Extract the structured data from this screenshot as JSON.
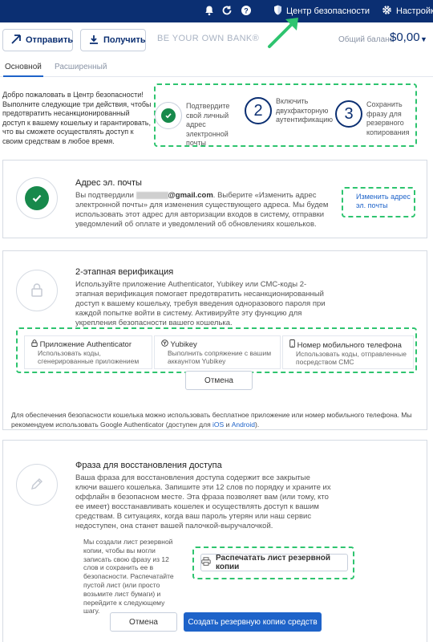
{
  "topbar": {
    "security_label": "Центр безопасности",
    "settings_label": "Настройки",
    "bell_icon": "bell-icon",
    "refresh_icon": "refresh-icon",
    "help_icon": "help-icon"
  },
  "header": {
    "send_label": "Отправить",
    "receive_label": "Получить",
    "brand": "BE YOUR OWN BANK®",
    "balance_label": "Общий баланс",
    "balance_value": "$0,00"
  },
  "tabs": [
    {
      "label": "Основной",
      "active": true
    },
    {
      "label": "Расширенный",
      "active": false
    }
  ],
  "welcome": {
    "text": "Добро пожаловать в Центр безопасности! Выполните следующие три действия, чтобы предотвратить несанкционированный доступ к вашему кошельку и гарантировать, что вы сможете осуществлять доступ к своим средствам в любое время."
  },
  "steps": [
    {
      "number": "",
      "done": true,
      "text": "Подтвердите свой личный адрес электронной почты"
    },
    {
      "number": "2",
      "done": false,
      "text": "Включить двухфакторную аутентификацию"
    },
    {
      "number": "3",
      "done": false,
      "text": "Сохранить фразу для резервного копирования"
    }
  ],
  "email_card": {
    "title": "Адрес эл. почты",
    "text_before": "Вы подтвердили ",
    "email_suffix": "@gmail.com",
    "text_after": ". Выберите «Изменить адрес электронной почты» для изменения существующего адреса. Мы будем использовать этот адрес для авторизации входов в систему, отправки уведомлений об оплате и уведомлений об обновлениях кошельков.",
    "change_link": "Изменить адрес эл. почты"
  },
  "twofa_card": {
    "title": "2-этапная верификация",
    "text": "Используйте приложение Authenticator, Yubikey или СМС-коды 2-этапная верификация помогает предотвратить несанкционированный доступ к вашему кошельку, требуя введения одноразового пароля при каждой попытке войти в систему. Активируйте эту функцию для укрепления безопасности вашего кошелька.",
    "options": [
      {
        "title": "Приложение Authenticator",
        "desc": "Использовать коды, сгенерированные приложением",
        "icon": "lock-icon"
      },
      {
        "title": "Yubikey",
        "desc": "Выполнить сопряжение с вашим аккаунтом Yubikey",
        "icon": "yubikey-icon"
      },
      {
        "title": "Номер мобильного телефона",
        "desc": "Использовать коды, отправленные посредством СМС",
        "icon": "phone-icon"
      }
    ],
    "cancel_label": "Отмена",
    "note": "Для обеспечения безопасности кошелька можно использовать бесплатное приложение или номер мобильного телефона. Мы рекомендуем использовать Google Authenticator (доступен для ",
    "note_ios": "iOS",
    "note_and": " и ",
    "note_android": "Android",
    "note_end": ")."
  },
  "phrase_card": {
    "title": "Фраза для восстановления доступа",
    "text": "Ваша фраза для восстановления доступа содержит все закрытые ключи вашего кошелька. Запишите эти 12 слов по порядку и храните их оффлайн в безопасном месте. Эта фраза позволяет вам (или тому, кто ее имеет) восстанавливать кошелек и осуществлять доступ к вашим средствам. В ситуациях, когда ваш пароль утерян или наш сервис недоступен, она станет вашей палочкой-выручалочкой.",
    "backup_text": "Мы создали лист резервной копии, чтобы вы могли записать свою фразу из 12 слов и сохранить ее в безопасности. Распечатайте пустой лист (или просто возьмите лист бумаги) и перейдите к следующему шагу.",
    "print_label": "Распечатать лист резервной копии",
    "cancel_label": "Отмена",
    "create_label": "Создать резервную копию средств"
  },
  "colors": {
    "navy": "#0b2f72",
    "accent": "#1e63c9",
    "highlight": "#2ec46f",
    "success": "#17894b"
  }
}
